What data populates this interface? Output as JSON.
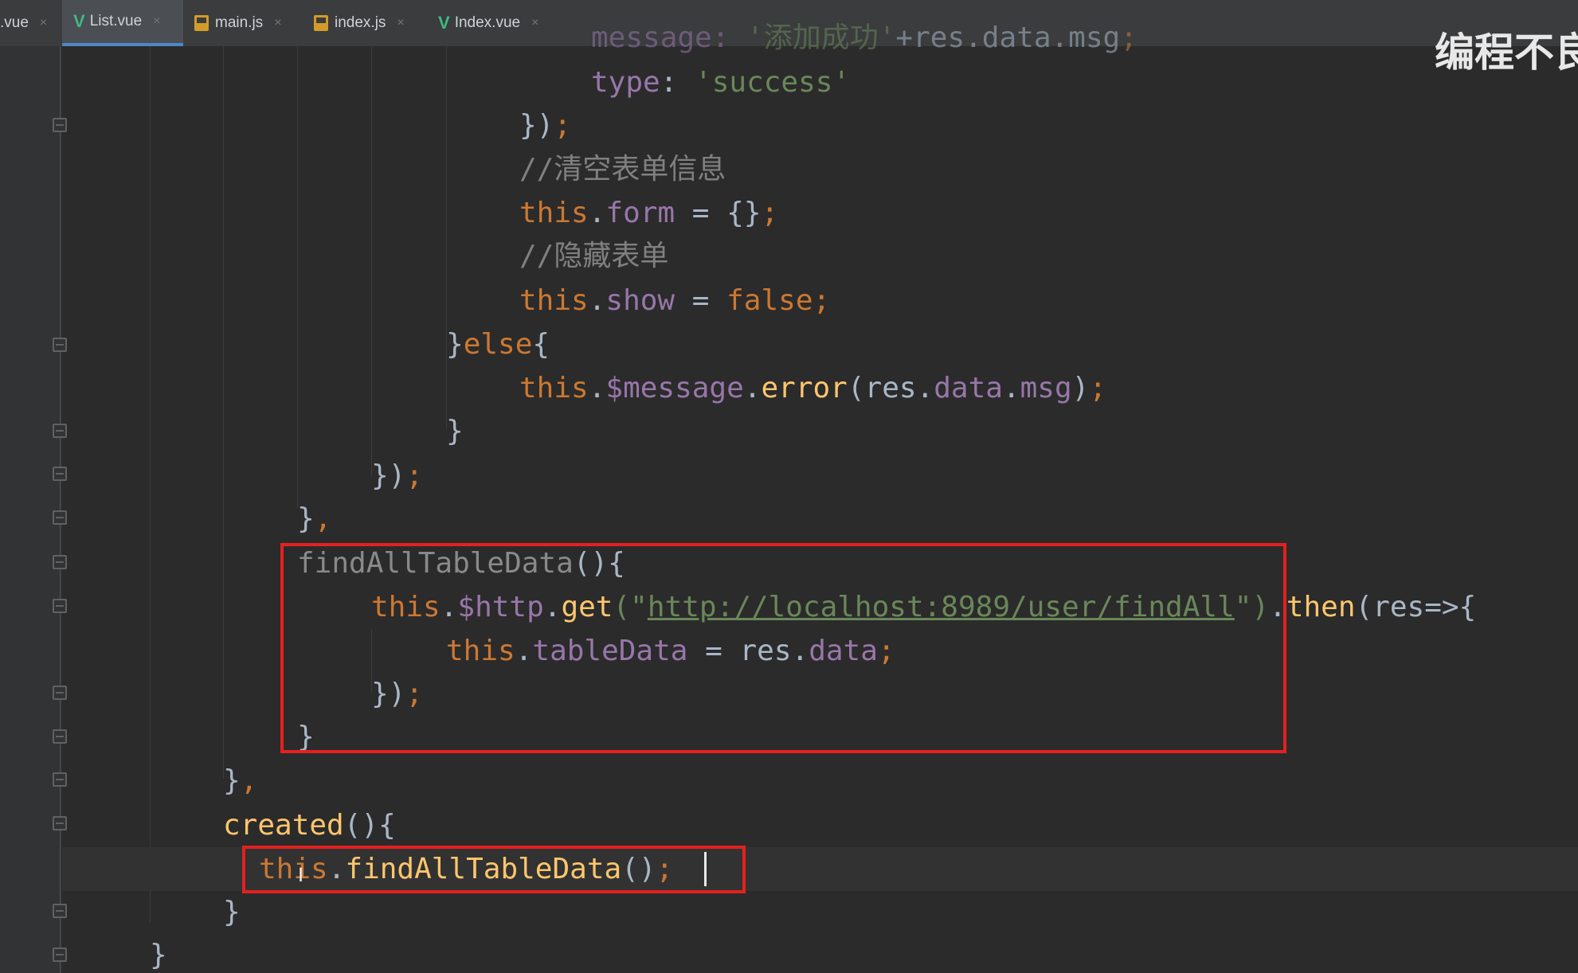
{
  "tabs": [
    {
      "label": ".vue",
      "icon": "none",
      "active": false
    },
    {
      "label": "List.vue",
      "icon": "vue-icon",
      "active": true
    },
    {
      "label": "main.js",
      "icon": "js-file-icon",
      "active": false
    },
    {
      "label": "index.js",
      "icon": "js-file-icon",
      "active": false
    },
    {
      "label": "Index.vue",
      "icon": "vue-icon",
      "active": false
    }
  ],
  "tab_close_glyph": "×",
  "watermark": "编程不良",
  "colors": {
    "keyword": "#cc7832",
    "string": "#6a8759",
    "property": "#9876aa",
    "function": "#ffc66d",
    "comment": "#808080",
    "plain": "#a9b7c6",
    "highlight_box": "#e52020",
    "editor_bg": "#2b2b2b"
  },
  "code": {
    "l0": {
      "a": "message:",
      "b": " '添加成功'",
      "c": "+res.data.msg",
      "d": ";"
    },
    "l1": {
      "a": "type",
      "b": ": ",
      "c": "'success'"
    },
    "l2": {
      "a": "})",
      "b": ";"
    },
    "l3": {
      "a": "//清空表单信息"
    },
    "l4": {
      "a": "this",
      "b": ".",
      "c": "form",
      "d": " = {}",
      "e": ";"
    },
    "l5": {
      "a": "//隐藏表单"
    },
    "l6": {
      "a": "this",
      "b": ".",
      "c": "show",
      "d": " = ",
      "e": "false",
      "f": ";"
    },
    "l7": {
      "a": "}",
      "b": "else",
      "c": "{"
    },
    "l8": {
      "a": "this",
      "b": ".",
      "c": "$message",
      "d": ".",
      "e": "error",
      "f": "(res.",
      "g": "data",
      "h": ".",
      "i": "msg",
      "j": ")",
      "k": ";"
    },
    "l9": {
      "a": "}"
    },
    "l10": {
      "a": "})",
      "b": ";"
    },
    "l11": {
      "a": "}",
      "b": ","
    },
    "l12": {
      "a": "findAllTableData",
      "b": "(){"
    },
    "l13": {
      "a": "this",
      "b": ".",
      "c": "$http",
      "d": ".",
      "e": "get",
      "f": "(\"",
      "g": "http://localhost:8989/user/findAll",
      "h": "\")",
      "i": ".",
      "j": "then",
      "k": "(res=>{"
    },
    "l14": {
      "a": "this",
      "b": ".",
      "c": "tableData",
      "d": " = res.",
      "e": "data",
      "f": ";"
    },
    "l15": {
      "a": "})",
      "b": ";"
    },
    "l16": {
      "a": "}"
    },
    "l17": {
      "a": "}",
      "b": ","
    },
    "l18": {
      "a": "created",
      "b": "(){"
    },
    "l19": {
      "a": "this",
      "b": ".",
      "c": "findAllTableData",
      "d": "()",
      "e": ";"
    },
    "l20": {
      "a": "}"
    },
    "l21": {
      "a": "}"
    }
  }
}
